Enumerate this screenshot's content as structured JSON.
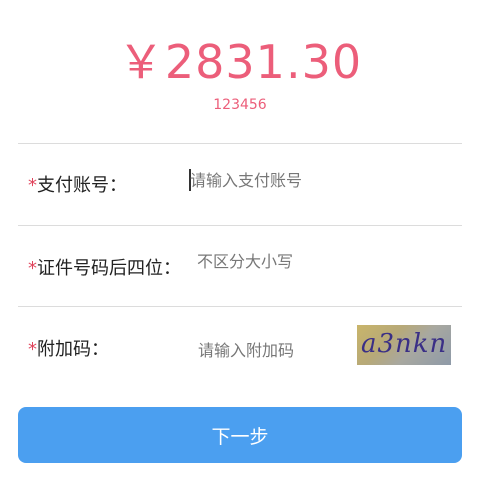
{
  "header": {
    "amount": "￥2831.30",
    "order_number": "123456"
  },
  "form": {
    "required_mark": "*",
    "account": {
      "label": "支付账号：",
      "placeholder": "请输入支付账号"
    },
    "id_last_four": {
      "label": "证件号码后四位：",
      "placeholder": "不区分大小写"
    },
    "captcha": {
      "label": "附加码：",
      "placeholder": "请输入附加码",
      "image_text": "a3nkn"
    }
  },
  "actions": {
    "next_label": "下一步"
  },
  "colors": {
    "amount": "#ec5e7a",
    "required": "#e0445c",
    "button": "#4b9ff0"
  }
}
